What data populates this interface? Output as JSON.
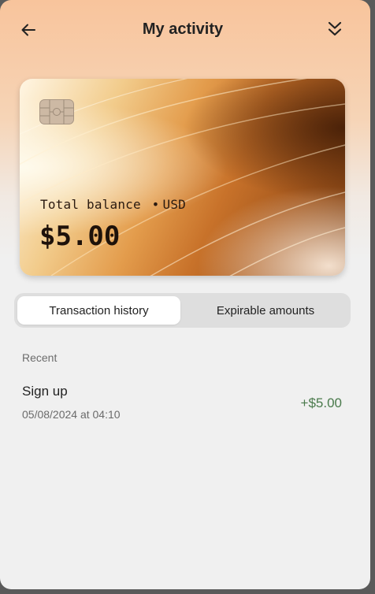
{
  "header": {
    "title": "My activity",
    "back_icon": "arrow-left-icon",
    "collapse_icon": "double-chevron-down-icon"
  },
  "card": {
    "label": "Total balance",
    "separator": "•",
    "currency": "USD",
    "balance": "$5.00",
    "chip_icon": "card-chip-icon"
  },
  "tabs": [
    {
      "label": "Transaction history",
      "active": true
    },
    {
      "label": "Expirable amounts",
      "active": false
    }
  ],
  "section": {
    "label": "Recent"
  },
  "transactions": [
    {
      "name": "Sign up",
      "date": "05/08/2024 at 04:10",
      "amount": "+$5.00"
    }
  ],
  "colors": {
    "positive_amount": "#4a7a4c",
    "header_gradient_top": "#f8c49c",
    "background": "#f0f0f0"
  }
}
